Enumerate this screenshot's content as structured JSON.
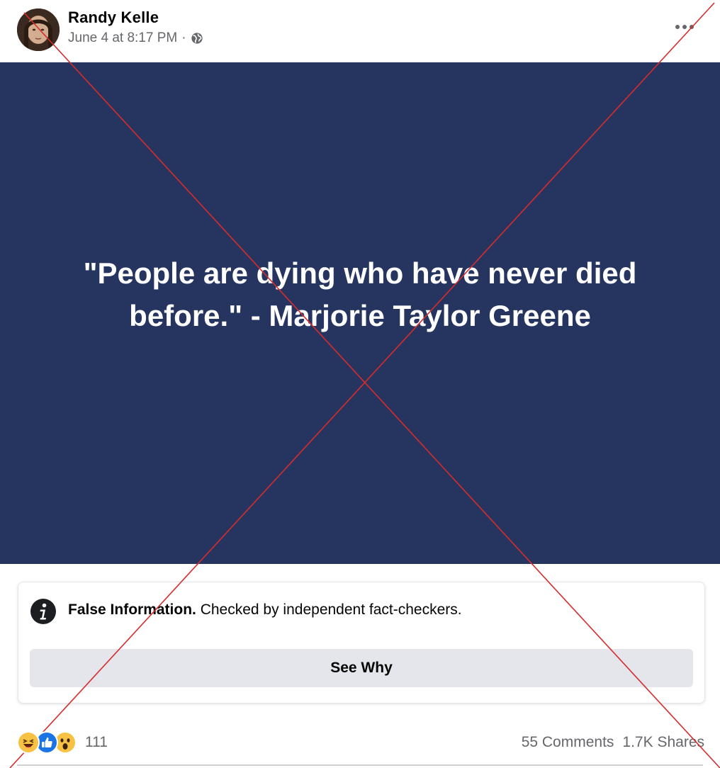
{
  "post": {
    "author": "Randy Kelle",
    "timestamp": "June 4 at 8:17 PM",
    "meta_separator": "·",
    "privacy_icon": "globe-icon",
    "more_icon": "more-options-icon"
  },
  "image": {
    "quote": "\"People are dying who have never died before.\" - Marjorie Taylor Greene",
    "background_color": "#253560"
  },
  "fact_check": {
    "title": "False Information.",
    "description": "Checked by independent fact-checkers.",
    "button_label": "See Why",
    "icon": "info-icon"
  },
  "engagement": {
    "reaction_icons": [
      "haha-icon",
      "like-icon",
      "wow-icon"
    ],
    "reaction_count": "111",
    "comments": "55 Comments",
    "shares": "1.7K Shares"
  },
  "overlay": {
    "mark": "red-x-cross",
    "color": "#d62c2c"
  }
}
